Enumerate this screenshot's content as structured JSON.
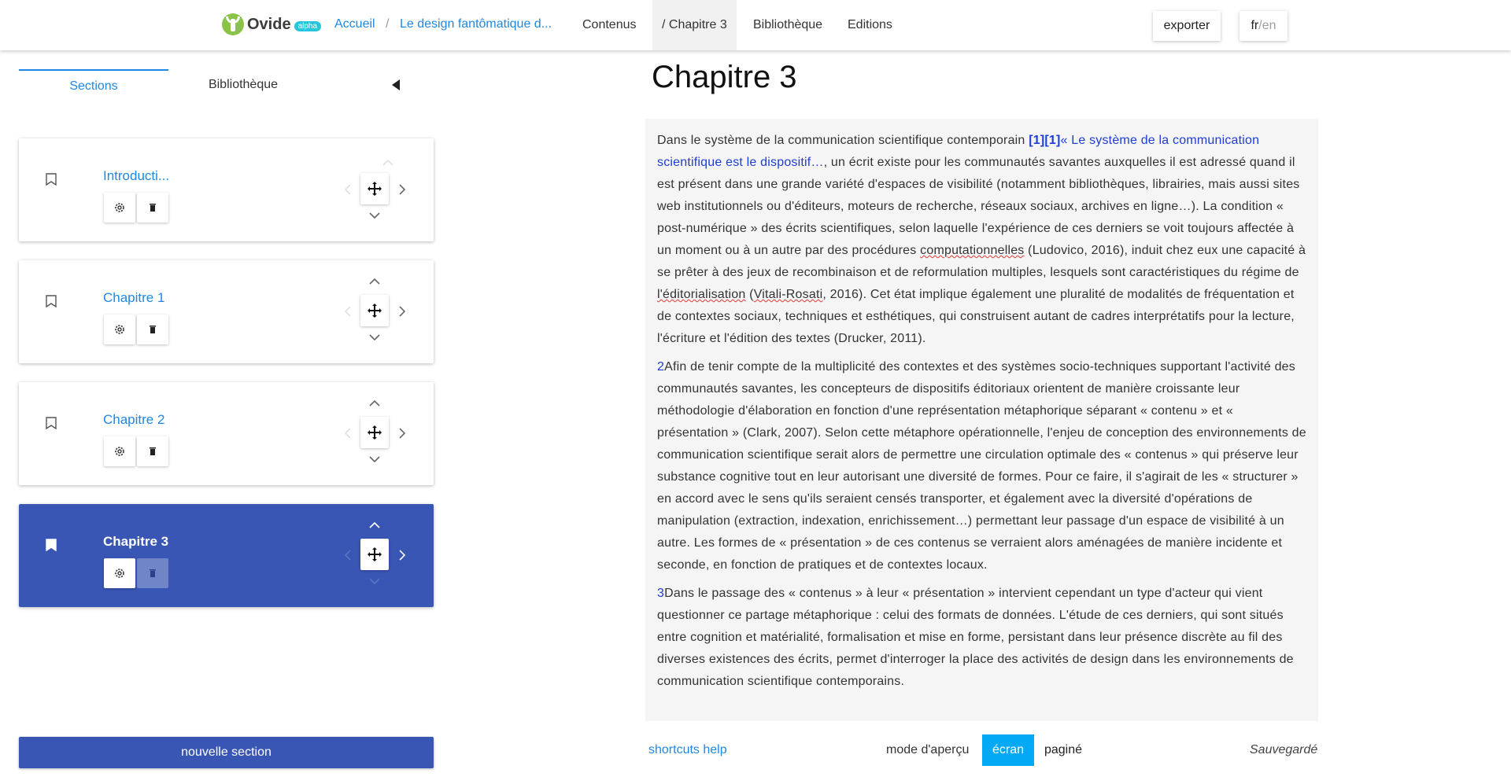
{
  "header": {
    "logo_text": "Ovide",
    "logo_badge": "alpha",
    "breadcrumb_home": "Accueil",
    "breadcrumb_separator": "/",
    "breadcrumb_story": "Le design fantômatique d...",
    "nav_contents": "Contenus",
    "nav_current": "/ Chapitre 3",
    "nav_library": "Bibliothèque",
    "nav_editions": "Editions",
    "export_label": "exporter",
    "lang_active": "fr",
    "lang_sep": "/",
    "lang_other": "en"
  },
  "sidebar": {
    "tabs": [
      {
        "label": "Sections",
        "active": true
      },
      {
        "label": "Bibliothèque",
        "active": false
      }
    ],
    "sections": [
      {
        "title": "Introducti...",
        "selected": false
      },
      {
        "title": "Chapitre 1",
        "selected": false
      },
      {
        "title": "Chapitre 2",
        "selected": false
      },
      {
        "title": "Chapitre 3",
        "selected": true
      }
    ],
    "new_section_label": "nouvelle section"
  },
  "editor": {
    "title": "Chapitre 3",
    "p1": {
      "t1": "Dans le système de la communication scientifique contemporain ",
      "note": "[1][1]",
      "link": "« Le système de la communication scientifique est le dispositif…",
      "t2": ", un écrit existe pour les communautés savantes auxquelles il est adressé quand il est présent dans une grande variété d'espaces de visibilité (notamment bibliothèques, librairies, mais aussi sites web institutionnels ou d'éditeurs, moteurs de recherche, réseaux sociaux, archives en ligne…). La condition « post-numérique » des écrits scientifiques, selon laquelle l'expérience de ces derniers se voit toujours affectée à un moment ou à un autre par des procédures ",
      "w1": "computationnelles",
      "t3": " (Ludovico, 2016), induit chez eux une capacité à se prêter à des jeux de recombinaison et de reformulation multiples, lesquels sont caractéristiques du régime de ",
      "w2": "l'éditorialisation",
      "t4": " (",
      "w3": "Vitali-Rosati",
      "t5": ", 2016). Cet état implique également une pluralité de modalités de fréquentation et de contextes sociaux, techniques et esthétiques, qui construisent autant de cadres interprétatifs pour la lecture, l'écriture et l'édition des textes (Drucker, 2011)."
    },
    "p2": {
      "num": "2",
      "text": "Afin de tenir compte de la multiplicité des contextes et des systèmes socio-techniques supportant l'activité des communautés savantes, les concepteurs de dispositifs éditoriaux orientent de manière croissante leur méthodologie d'élaboration en fonction d'une représentation métaphorique séparant « contenu » et « présentation » (Clark, 2007). Selon cette métaphore opérationnelle, l'enjeu de conception des environnements de communication scientifique serait alors de permettre une circulation optimale des « contenus » qui préserve leur substance cognitive tout en leur autorisant une diversité de formes. Pour ce faire, il s'agirait de les « structurer » en accord avec le sens qu'ils seraient censés transporter, et également avec la diversité d'opérations de manipulation (extraction, indexation, enrichissement…) permettant leur passage d'un espace de visibilité à un autre. Les formes de « présentation » de ces contenus se verraient alors aménagées de manière incidente et seconde, en fonction de pratiques et de contextes locaux."
    },
    "p3": {
      "num": "3",
      "text": "Dans le passage des « contenus » à leur « présentation » intervient cependant un type d'acteur qui vient questionner ce partage métaphorique : celui des formats de données. L'étude de ces derniers, qui sont situés entre cognition et matérialité, formalisation et mise en forme, persistant dans leur présence discrète au fil des diverses existences des écrits, permet d'interroger la place des activités de design dans les environnements de communication scientifique contemporains."
    }
  },
  "footer": {
    "shortcuts_label": "shortcuts help",
    "mode_label": "mode d'aperçu",
    "mode_screen": "écran",
    "mode_paged": "paginé",
    "saved_label": "Sauvegardé"
  },
  "colors": {
    "accent": "#1e88e5",
    "selected_card": "#3a56b5",
    "mode_active": "#03a9f4",
    "note_link": "#1e3cd8"
  }
}
